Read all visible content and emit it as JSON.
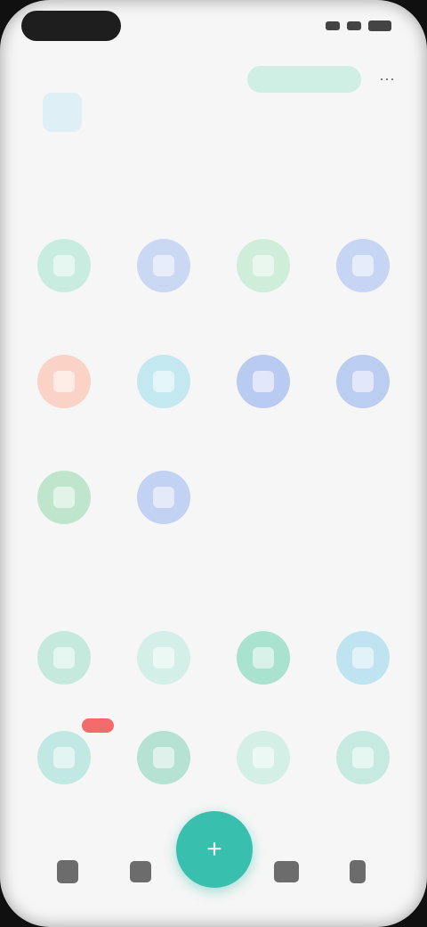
{
  "header": {
    "label": "",
    "subtitle": "",
    "action_label": ""
  },
  "sections": [
    {
      "title": "",
      "apps": [
        {
          "label": "",
          "color": "#c8ede0",
          "icon": "app-icon"
        },
        {
          "label": "",
          "color": "#cad8f4",
          "icon": "app-icon"
        },
        {
          "label": "",
          "color": "#cfeed9",
          "icon": "app-icon"
        },
        {
          "label": "",
          "color": "#c6d5f4",
          "icon": "app-icon"
        },
        {
          "label": "",
          "color": "#fbd2c6",
          "icon": "app-icon"
        },
        {
          "label": "",
          "color": "#c4e8ef",
          "icon": "app-icon"
        },
        {
          "label": "",
          "color": "#b9cbf1",
          "icon": "app-icon"
        },
        {
          "label": "",
          "color": "#bccdf2",
          "icon": "app-icon"
        },
        {
          "label": "",
          "color": "#bfe6cc",
          "icon": "app-icon"
        },
        {
          "label": "",
          "color": "#c2d2f3",
          "icon": "app-icon"
        }
      ]
    },
    {
      "title": "",
      "apps": [
        {
          "label": "",
          "color": "#c5eadd",
          "icon": "app-icon"
        },
        {
          "label": "",
          "color": "#d4efe7",
          "icon": "app-icon"
        },
        {
          "label": "",
          "color": "#a9e2cf",
          "icon": "app-icon"
        },
        {
          "label": "",
          "color": "#bfe3f1",
          "icon": "app-icon"
        },
        {
          "label": "",
          "color": "#c1e8e2",
          "icon": "app-icon",
          "badge": ""
        },
        {
          "label": "",
          "color": "#b5e2d2",
          "icon": "app-icon"
        },
        {
          "label": "",
          "color": "#d3efe6",
          "icon": "app-icon"
        },
        {
          "label": "",
          "color": "#c6eadf",
          "icon": "app-icon"
        }
      ]
    }
  ],
  "bottom_nav": {
    "items": [
      {
        "icon": "home-icon"
      },
      {
        "icon": "grid-icon"
      },
      {
        "icon": "chat-icon"
      },
      {
        "icon": "profile-icon"
      }
    ],
    "fab_icon": "plus-icon",
    "fab_color": "#39bfae"
  }
}
